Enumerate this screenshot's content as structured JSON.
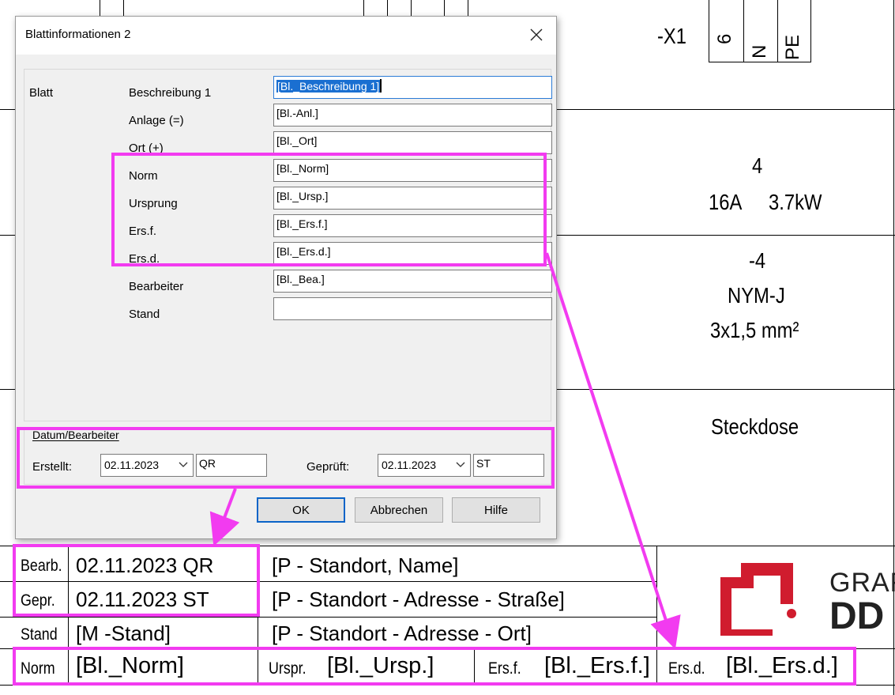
{
  "dialog": {
    "title": "Blattinformationen 2",
    "section_label": "Blatt",
    "fields": [
      {
        "label": "Beschreibung 1",
        "value": "[Bl._Beschreibung 1]"
      },
      {
        "label": "Anlage (=)",
        "value": "[Bl.-Anl.]"
      },
      {
        "label": "Ort (+)",
        "value": "[Bl._Ort]"
      },
      {
        "label": "Norm",
        "value": "[Bl._Norm]"
      },
      {
        "label": "Ursprung",
        "value": "[Bl._Ursp.]"
      },
      {
        "label": "Ers.f.",
        "value": "[Bl._Ers.f.]"
      },
      {
        "label": "Ers.d.",
        "value": "[Bl._Ers.d.]"
      },
      {
        "label": "Bearbeiter",
        "value": "[Bl._Bea.]"
      },
      {
        "label": "Stand",
        "value": ""
      }
    ],
    "group": {
      "title": "Datum/Bearbeiter",
      "created_label": "Erstellt:",
      "created_date": "02.11.2023",
      "created_user": "QR",
      "checked_label": "Geprüft:",
      "checked_date": "02.11.2023",
      "checked_user": "ST"
    },
    "buttons": {
      "ok": "OK",
      "cancel": "Abbrechen",
      "help": "Hilfe"
    }
  },
  "drawing": {
    "terminal": {
      "name": "-X1",
      "pins": [
        "6",
        "N",
        "PE"
      ]
    },
    "circuit": {
      "number": "4",
      "rating": "16A",
      "power": "3.7kW"
    },
    "cable": {
      "name": "-4",
      "type": "NYM-J",
      "section": "3x1,5 mm²"
    },
    "device": "Steckdose"
  },
  "title_block": {
    "rows": [
      {
        "label": "Bearb.",
        "value": "02.11.2023 QR",
        "project": "[P - Standort, Name]"
      },
      {
        "label": "Gepr.",
        "value": "02.11.2023 ST",
        "project": "[P - Standort - Adresse - Straße]"
      },
      {
        "label": "Stand",
        "value": "[M -Stand]",
        "project": "[P - Standort - Adresse - Ort]"
      }
    ],
    "norm_row": {
      "norm_label": "Norm",
      "norm_value": "[Bl._Norm]",
      "ursp_label": "Urspr.",
      "ursp_value": "[Bl._Ursp.]",
      "ersf_label": "Ers.f.",
      "ersf_value": "[Bl._Ers.f.]",
      "ersd_label": "Ers.d.",
      "ersd_value": "[Bl._Ers.d.]"
    },
    "logo_text_top": "GRAF",
    "logo_text_bottom": "DD"
  },
  "colors": {
    "highlight": "#f23bf0",
    "logo_red": "#d01c2e",
    "selection": "#1a6fd1"
  }
}
